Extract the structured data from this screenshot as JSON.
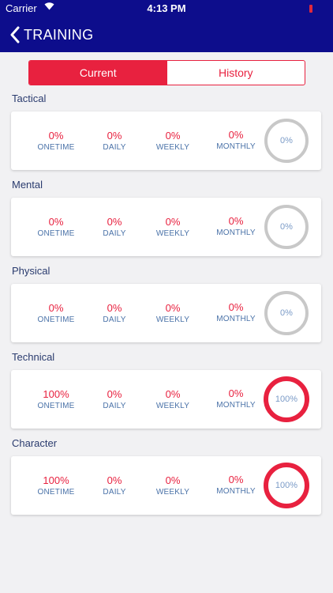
{
  "status_bar": {
    "carrier": "Carrier",
    "time": "4:13 PM"
  },
  "header": {
    "title": "TRAINING"
  },
  "tabs": {
    "current": "Current",
    "history": "History"
  },
  "labels": {
    "onetime": "ONETIME",
    "daily": "DAILY",
    "weekly": "WEEKLY",
    "monthly": "MONTHLY"
  },
  "colors": {
    "brand": "#0d0d8c",
    "accent": "#e8213f",
    "ring_empty": "#c8c8c8"
  },
  "sections": [
    {
      "name": "Tactical",
      "onetime": "0%",
      "daily": "0%",
      "weekly": "0%",
      "monthly": "0%",
      "total": "0%",
      "progress": 0
    },
    {
      "name": "Mental",
      "onetime": "0%",
      "daily": "0%",
      "weekly": "0%",
      "monthly": "0%",
      "total": "0%",
      "progress": 0
    },
    {
      "name": "Physical",
      "onetime": "0%",
      "daily": "0%",
      "weekly": "0%",
      "monthly": "0%",
      "total": "0%",
      "progress": 0
    },
    {
      "name": "Technical",
      "onetime": "100%",
      "daily": "0%",
      "weekly": "0%",
      "monthly": "0%",
      "total": "100%",
      "progress": 1
    },
    {
      "name": "Character",
      "onetime": "100%",
      "daily": "0%",
      "weekly": "0%",
      "monthly": "0%",
      "total": "100%",
      "progress": 1
    }
  ]
}
